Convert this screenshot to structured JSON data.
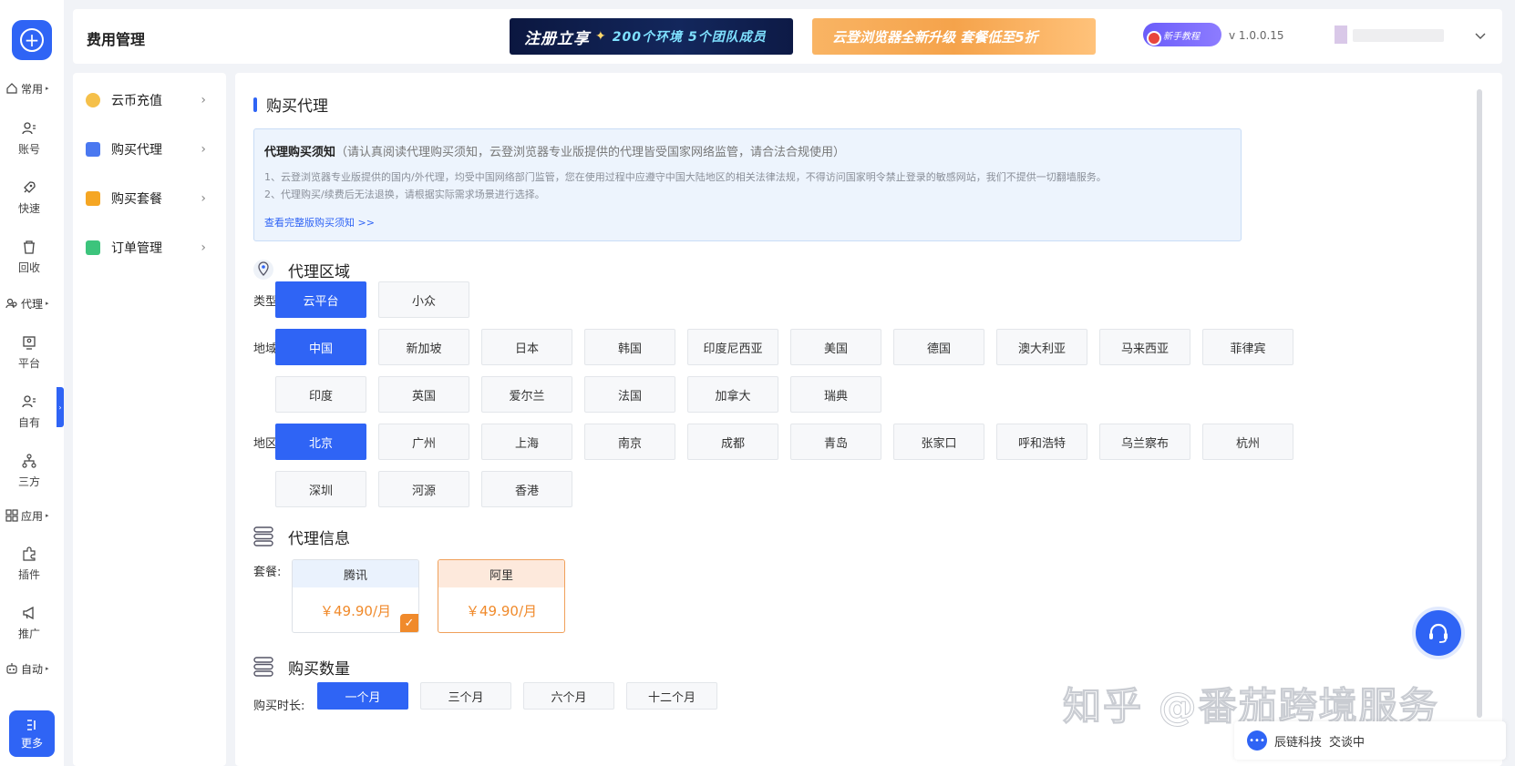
{
  "rail": {
    "groups": {
      "common": "常用",
      "proxy": "代理",
      "apps": "应用",
      "auto": "自动"
    },
    "items": {
      "account": "账号",
      "quick": "快速",
      "recycle": "回收",
      "platform": "平台",
      "own": "自有",
      "third": "三方",
      "plugin": "插件",
      "promote": "推广"
    },
    "more": "更多"
  },
  "header": {
    "title": "费用管理",
    "banner1": {
      "main": "注册立享",
      "env": "200个环境",
      "team": "5个团队成员"
    },
    "banner2": "云登浏览器全新升级 套餐低至5折",
    "tutorial": "新手教程",
    "version": "v 1.0.0.15"
  },
  "submenu": [
    {
      "label": "云币充值"
    },
    {
      "label": "购买代理"
    },
    {
      "label": "购买套餐"
    },
    {
      "label": "订单管理"
    }
  ],
  "page": {
    "title": "购买代理",
    "notice": {
      "heading": "代理购买须知",
      "subheading": "（请认真阅读代理购买须知，云登浏览器专业版提供的代理皆受国家网络监管，请合法合规使用）",
      "line1": "1、云登浏览器专业版提供的国内/外代理，均受中国网络部门监管，您在使用过程中应遵守中国大陆地区的相关法律法规，不得访问国家明令禁止登录的敏感网站，我们不提供一切翻墙服务。",
      "line2": "2、代理购买/续费后无法退换，请根据实际需求场景进行选择。",
      "link": "查看完整版购买须知 >>"
    },
    "region_section": "代理区域",
    "type_label": "类型:",
    "types": [
      "云平台",
      "小众"
    ],
    "area_label": "地域:",
    "areas": [
      "中国",
      "新加坡",
      "日本",
      "韩国",
      "印度尼西亚",
      "美国",
      "德国",
      "澳大利亚",
      "马来西亚",
      "菲律宾",
      "印度",
      "英国",
      "爱尔兰",
      "法国",
      "加拿大",
      "瑞典"
    ],
    "district_label": "地区:",
    "districts": [
      "北京",
      "广州",
      "上海",
      "南京",
      "成都",
      "青岛",
      "张家口",
      "呼和浩特",
      "乌兰察布",
      "杭州",
      "深圳",
      "河源",
      "香港"
    ],
    "info_section": "代理信息",
    "package_label": "套餐:",
    "packages": [
      {
        "name": "腾讯",
        "price": "￥49.90/月"
      },
      {
        "name": "阿里",
        "price": "￥49.90/月"
      }
    ],
    "qty_section": "购买数量",
    "duration_label": "购买时长:",
    "durations": [
      "一个月",
      "三个月",
      "六个月",
      "十二个月"
    ]
  },
  "chat": {
    "company": "辰链科技",
    "status": "交谈中"
  },
  "watermark": "知乎 @番茄跨境服务",
  "colors": {
    "primary": "#2f64f5",
    "price": "#f08a2b",
    "notice_bg": "#edf4fd"
  }
}
